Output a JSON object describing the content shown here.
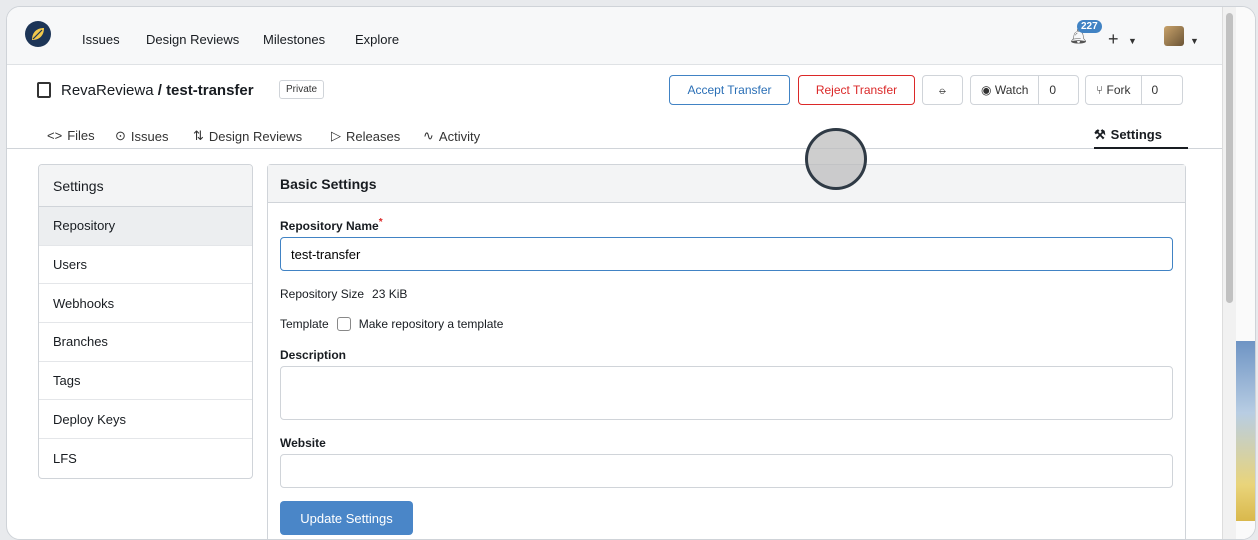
{
  "nav": {
    "links": [
      "Issues",
      "Design Reviews",
      "Milestones",
      "Explore"
    ],
    "notification_count": "227",
    "plus": "+"
  },
  "repo": {
    "owner": "RevaReviewa",
    "separator": " / ",
    "name": "test-transfer",
    "visibility": "Private",
    "accept_label": "Accept Transfer",
    "reject_label": "Reject Transfer",
    "watch_label": "Watch",
    "watch_count": "0",
    "fork_label": "Fork",
    "fork_count": "0"
  },
  "tabs": {
    "files": "Files",
    "issues": "Issues",
    "design_reviews": "Design Reviews",
    "releases": "Releases",
    "activity": "Activity",
    "settings": "Settings"
  },
  "sidebar": {
    "title": "Settings",
    "items": [
      "Repository",
      "Users",
      "Webhooks",
      "Branches",
      "Tags",
      "Deploy Keys",
      "LFS"
    ]
  },
  "form": {
    "heading": "Basic Settings",
    "name_label": "Repository Name",
    "required_mark": "*",
    "name_value": "test-transfer",
    "size_label": "Repository Size",
    "size_value": "23 KiB",
    "template_label": "Template",
    "template_checkbox": "Make repository a template",
    "description_label": "Description",
    "description_value": "",
    "website_label": "Website",
    "website_value": "",
    "update_label": "Update Settings"
  },
  "colors": {
    "accent": "#4183c4",
    "danger": "#db2828"
  }
}
